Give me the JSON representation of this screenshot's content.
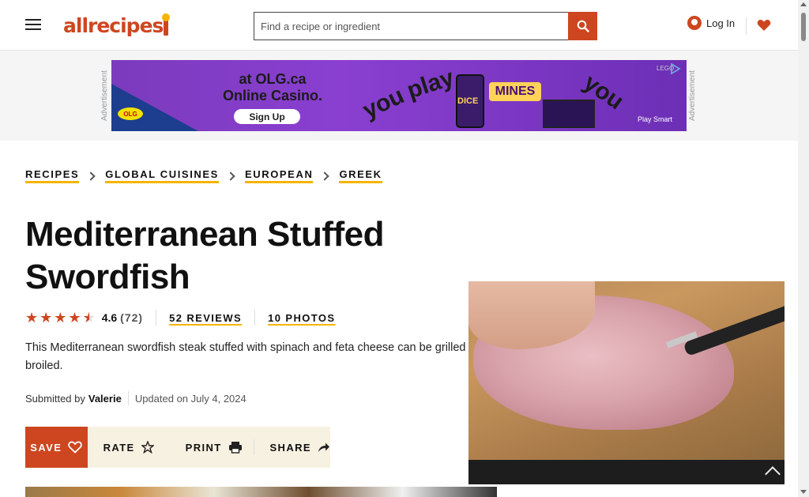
{
  "header": {
    "logo_text": "allrecipes",
    "search_placeholder": "Find a recipe or ingredient",
    "login_label": "Log In",
    "brand_color": "#ce4620",
    "accent_color": "#f6b400"
  },
  "ad": {
    "left_label": "Advertisement",
    "right_label": "Advertisement",
    "headline_line1": "at OLG.ca",
    "headline_line2": "Online Casino.",
    "signup_label": "Sign Up",
    "slogan_words": [
      "you",
      "play",
      "you"
    ],
    "game_label": "MINES",
    "dice_label": "DICE",
    "playsmart_label": "Play Smart",
    "brand_label": "OLG",
    "corner_label": "LEGO"
  },
  "breadcrumbs": [
    "Recipes",
    "Global Cuisines",
    "European",
    "Greek"
  ],
  "recipe": {
    "title": "Mediterranean Stuffed Swordfish",
    "rating_avg": "4.6",
    "rating_count": "(72)",
    "stars_filled": 4.5,
    "reviews_label": "52 REVIEWS",
    "photos_label": "10 PHOTOS",
    "description": "This Mediterranean swordfish steak stuffed with spinach and feta cheese can be grilled or broiled.",
    "submitted_prefix": "Submitted by",
    "author": "Valerie",
    "updated": "Updated on July 4, 2024"
  },
  "actions": {
    "save_label": "SAVE",
    "rate_label": "RATE",
    "print_label": "PRINT",
    "share_label": "SHARE"
  }
}
